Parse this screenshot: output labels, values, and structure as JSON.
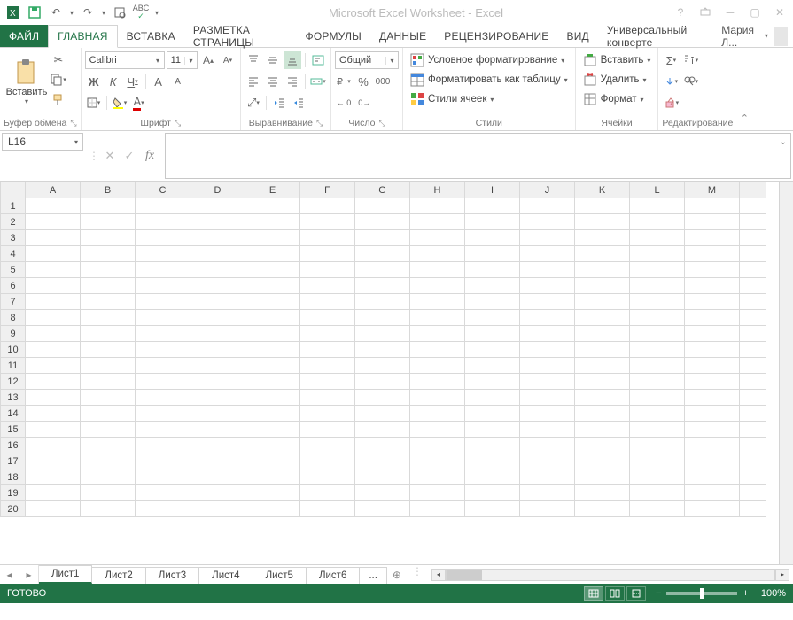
{
  "title": "Microsoft Excel Worksheet - Excel",
  "user": "Мария Л...",
  "tabs": {
    "file": "ФАЙЛ",
    "home": "ГЛАВНАЯ",
    "insert": "ВСТАВКА",
    "layout": "РАЗМЕТКА СТРАНИЦЫ",
    "formulas": "ФОРМУЛЫ",
    "data": "ДАННЫЕ",
    "review": "РЕЦЕНЗИРОВАНИЕ",
    "view": "ВИД",
    "addin": "Универсальный конверте"
  },
  "ribbon": {
    "clipboard": {
      "label": "Буфер обмена",
      "paste": "Вставить"
    },
    "font": {
      "label": "Шрифт",
      "name": "Calibri",
      "size": "11",
      "bold": "Ж",
      "italic": "К",
      "underline": "Ч"
    },
    "align": {
      "label": "Выравнивание"
    },
    "number": {
      "label": "Число",
      "format": "Общий"
    },
    "styles": {
      "label": "Стили",
      "cond": "Условное форматирование",
      "table": "Форматировать как таблицу",
      "cell": "Стили ячеек"
    },
    "cells": {
      "label": "Ячейки",
      "insert": "Вставить",
      "delete": "Удалить",
      "format": "Формат"
    },
    "editing": {
      "label": "Редактирование"
    }
  },
  "namebox": "L16",
  "columns": [
    "A",
    "B",
    "C",
    "D",
    "E",
    "F",
    "G",
    "H",
    "I",
    "J",
    "K",
    "L",
    "M"
  ],
  "rows": [
    "1",
    "2",
    "3",
    "4",
    "5",
    "6",
    "7",
    "8",
    "9",
    "10",
    "11",
    "12",
    "13",
    "14",
    "15",
    "16",
    "17",
    "18",
    "19",
    "20"
  ],
  "sheets": [
    "Лист1",
    "Лист2",
    "Лист3",
    "Лист4",
    "Лист5",
    "Лист6"
  ],
  "sheets_more": "...",
  "status": {
    "ready": "ГОТОВО",
    "zoom": "100%"
  }
}
